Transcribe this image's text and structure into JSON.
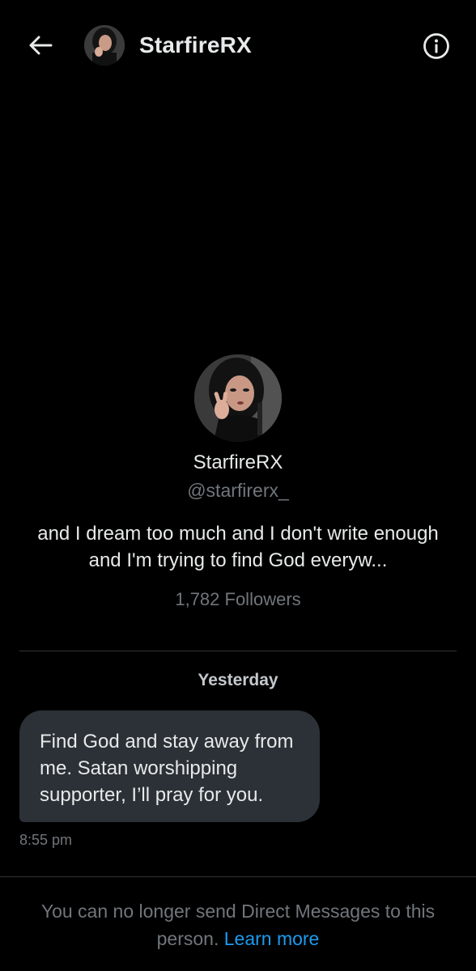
{
  "header": {
    "title": "StarfireRX",
    "back_icon": "arrow-left-icon",
    "info_icon": "info-circle-icon"
  },
  "profile": {
    "name": "StarfireRX",
    "handle": "@starfirerx_",
    "bio": "and I dream too much and I don't write enough and I'm trying to find God everyw...",
    "followers": "1,782 Followers"
  },
  "conversation": {
    "date_separator": "Yesterday",
    "messages": [
      {
        "text": "Find God and stay away from me. Satan worshipping supporter, I’ll pray for you.",
        "time": "8:55 pm"
      }
    ]
  },
  "footer": {
    "notice": "You can no longer send Direct Messages to this person.",
    "link": "Learn more"
  },
  "colors": {
    "background": "#000000",
    "primary_text": "#e7e9ea",
    "secondary_text": "#71767b",
    "bubble": "#2b3136",
    "link": "#1d9bf0"
  }
}
